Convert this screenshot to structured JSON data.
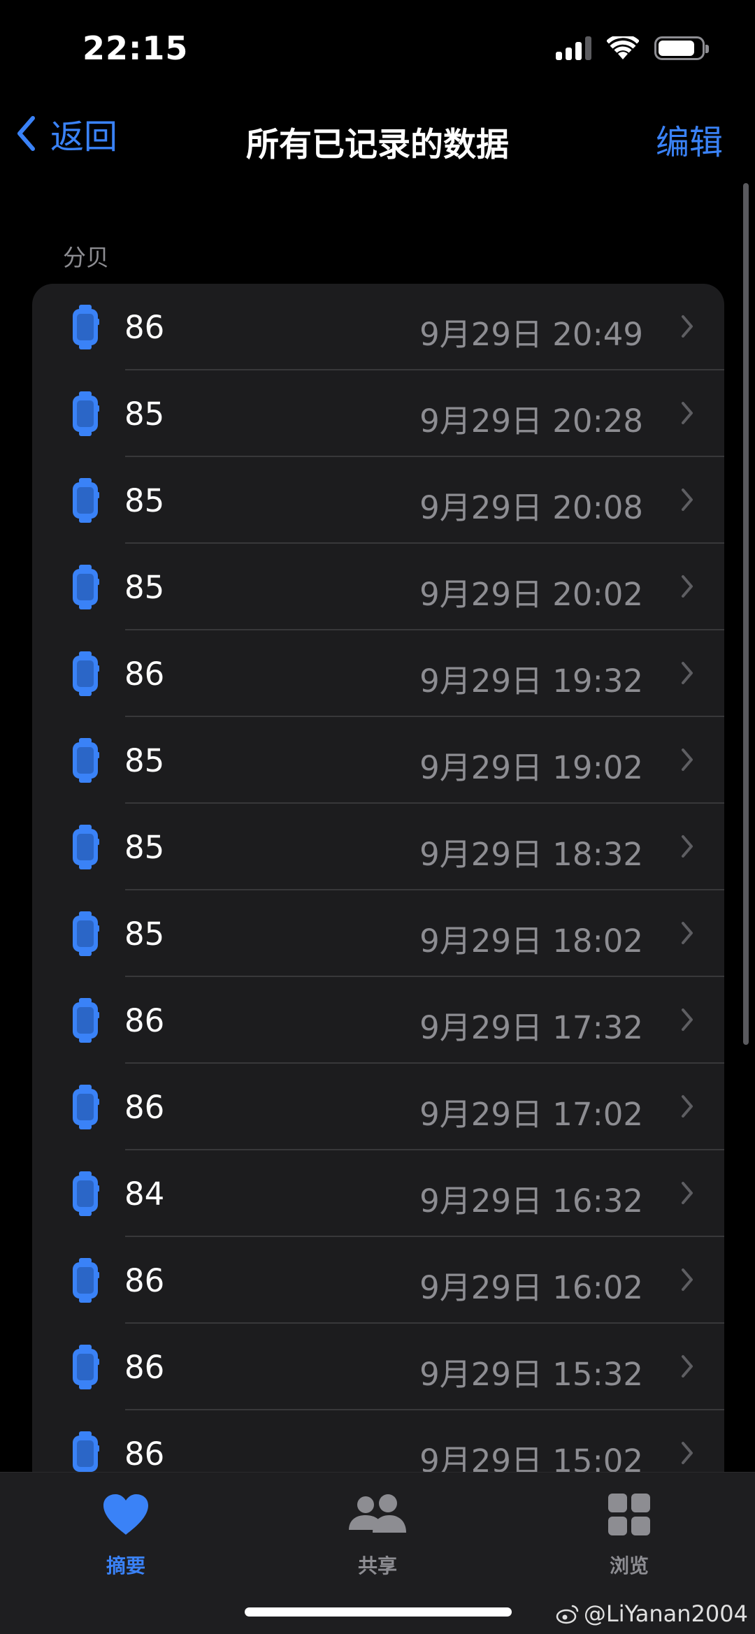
{
  "status_bar": {
    "time": "22:15",
    "battery_level": 0.85
  },
  "nav": {
    "back_label": "返回",
    "title": "所有已记录的数据",
    "edit_label": "编辑"
  },
  "section": {
    "header": "分贝"
  },
  "rows": [
    {
      "value": "86",
      "date": "9月29日 20:49"
    },
    {
      "value": "85",
      "date": "9月29日 20:28"
    },
    {
      "value": "85",
      "date": "9月29日 20:08"
    },
    {
      "value": "85",
      "date": "9月29日 20:02"
    },
    {
      "value": "86",
      "date": "9月29日 19:32"
    },
    {
      "value": "85",
      "date": "9月29日 19:02"
    },
    {
      "value": "85",
      "date": "9月29日 18:32"
    },
    {
      "value": "85",
      "date": "9月29日 18:02"
    },
    {
      "value": "86",
      "date": "9月29日 17:32"
    },
    {
      "value": "86",
      "date": "9月29日 17:02"
    },
    {
      "value": "84",
      "date": "9月29日 16:32"
    },
    {
      "value": "86",
      "date": "9月29日 16:02"
    },
    {
      "value": "86",
      "date": "9月29日 15:32"
    },
    {
      "value": "86",
      "date": "9月29日 15:02"
    }
  ],
  "row_icon": "apple-watch-icon",
  "tabs": {
    "summary": {
      "label": "摘要",
      "icon": "heart-icon"
    },
    "sharing": {
      "label": "共享",
      "icon": "people-icon"
    },
    "browse": {
      "label": "浏览",
      "icon": "grid-icon"
    }
  },
  "watermark": {
    "text": "@LiYanan2004",
    "icon": "weibo-icon"
  },
  "colors": {
    "accent": "#3a82f7",
    "background": "#000000",
    "card": "#1c1c1e",
    "secondary_text": "#8d8d92"
  }
}
